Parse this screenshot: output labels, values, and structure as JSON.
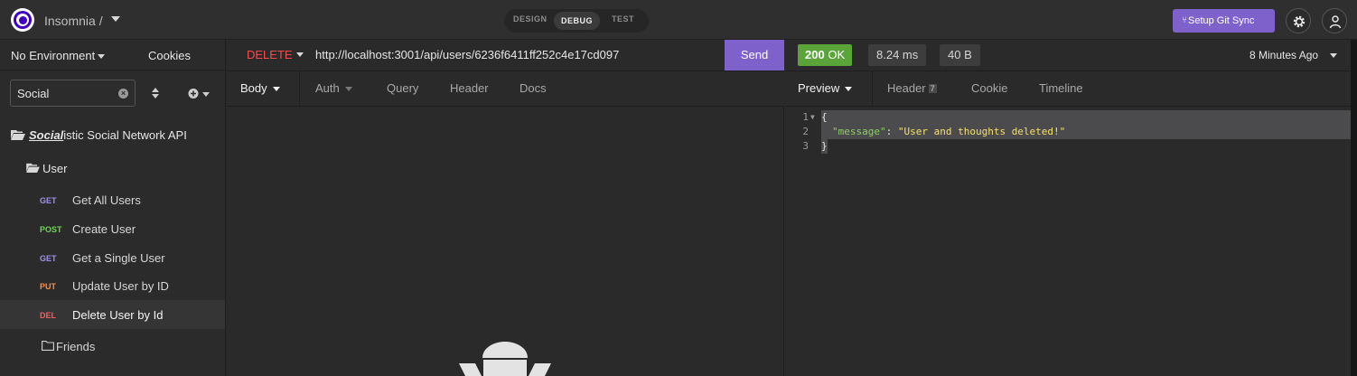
{
  "topbar": {
    "app_title": "Insomnia /",
    "modes": [
      "DESIGN",
      "DEBUG",
      "TEST"
    ],
    "active_mode": "DEBUG",
    "git_sync_label": "Setup Git Sync",
    "git_icon": "⑂"
  },
  "sidebar": {
    "environment": "No Environment",
    "cookies_label": "Cookies",
    "filter_value": "Social",
    "collection": {
      "name_prefix": "Social",
      "name_rest": "istic Social Network API"
    },
    "folder_user": "User",
    "requests": [
      {
        "method": "GET",
        "name": "Get All Users"
      },
      {
        "method": "POST",
        "name": "Create User"
      },
      {
        "method": "GET",
        "name": "Get a Single User"
      },
      {
        "method": "PUT",
        "name": "Update User by ID"
      },
      {
        "method": "DEL",
        "name": "Delete User by Id"
      }
    ],
    "folder_friends": "Friends"
  },
  "request": {
    "method": "DELETE",
    "url": "http://localhost:3001/api/users/6236f6411ff252c4e17cd097",
    "send_label": "Send",
    "tabs": [
      "Body",
      "Auth",
      "Query",
      "Header",
      "Docs"
    ]
  },
  "response": {
    "status_code": "200",
    "status_text": "OK",
    "time": "8.24 ms",
    "size": "40 B",
    "age": "8 Minutes Ago",
    "tabs": [
      "Preview",
      "Header",
      "Cookie",
      "Timeline"
    ],
    "header_count": "7",
    "body_lines": [
      {
        "num": "1",
        "text": "{"
      },
      {
        "num": "2",
        "key": "\"message\"",
        "sep": ": ",
        "value": "\"User and thoughts deleted!\""
      },
      {
        "num": "3",
        "text": "}"
      }
    ]
  },
  "colors": {
    "accent": "#7e61ca",
    "status_ok": "#5aa43a",
    "delete_method": "#ff4b4b"
  }
}
